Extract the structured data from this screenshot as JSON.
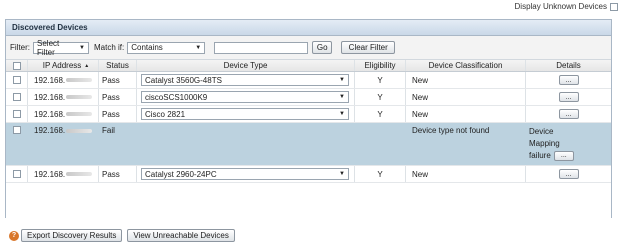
{
  "top": {
    "display_unknown_label": "Display Unknown Devices"
  },
  "panel": {
    "title": "Discovered Devices"
  },
  "filter": {
    "label": "Filter:",
    "filter_value": "Select Filter",
    "match_label": "Match if:",
    "match_value": "Contains",
    "text_value": "",
    "go_label": "Go",
    "clear_label": "Clear Filter"
  },
  "table": {
    "headers": [
      "IP Address",
      "Status",
      "Device Type",
      "Eligibility",
      "Device Classification",
      "Details"
    ],
    "rows": [
      {
        "ip": "192.168.",
        "status": "Pass",
        "device_type": "Catalyst 3560G-48TS",
        "eligibility": "Y",
        "classification": "New",
        "details": "..."
      },
      {
        "ip": "192.168.",
        "status": "Pass",
        "device_type": "ciscoSCS1000K9",
        "eligibility": "Y",
        "classification": "New",
        "details": "..."
      },
      {
        "ip": "192.168.",
        "status": "Pass",
        "device_type": "Cisco 2821",
        "eligibility": "Y",
        "classification": "New",
        "details": "..."
      },
      {
        "ip": "192.168.",
        "status": "Fail",
        "device_type": "",
        "eligibility": "",
        "classification": "Device type not found",
        "detail_line1": "Device",
        "detail_line2": "Mapping",
        "detail_line3": "failure",
        "details": "..."
      },
      {
        "ip": "192.168.",
        "status": "Pass",
        "device_type": "Catalyst 2960-24PC",
        "eligibility": "Y",
        "classification": "New",
        "details": "..."
      }
    ]
  },
  "bottom": {
    "export_label": "Export Discovery Results",
    "unreachable_label": "View Unreachable Devices"
  }
}
